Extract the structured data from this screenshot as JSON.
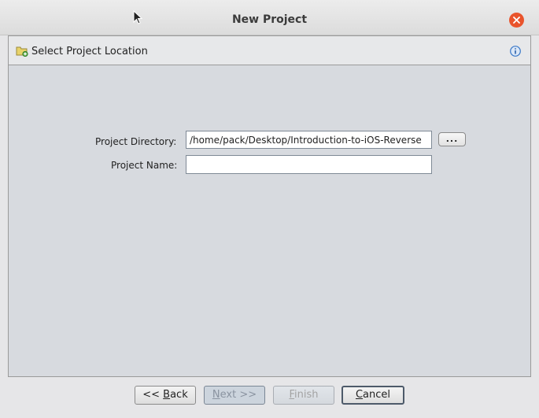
{
  "window": {
    "title": "New Project"
  },
  "header": {
    "label": "Select Project Location"
  },
  "form": {
    "directory_label": "Project Directory:",
    "directory_value": "/home/pack/Desktop/Introduction-to-iOS-Reverse",
    "browse_label": "...",
    "name_label": "Project Name:",
    "name_value": ""
  },
  "buttons": {
    "back_prefix": "<< ",
    "back_mnemonic": "B",
    "back_rest": "ack",
    "next_mnemonic": "N",
    "next_rest": "ext >>",
    "finish_mnemonic": "F",
    "finish_rest": "inish",
    "cancel_mnemonic": "C",
    "cancel_rest": "ancel"
  },
  "colors": {
    "close_button": "#e9542c",
    "info_icon": "#3a78c8"
  }
}
